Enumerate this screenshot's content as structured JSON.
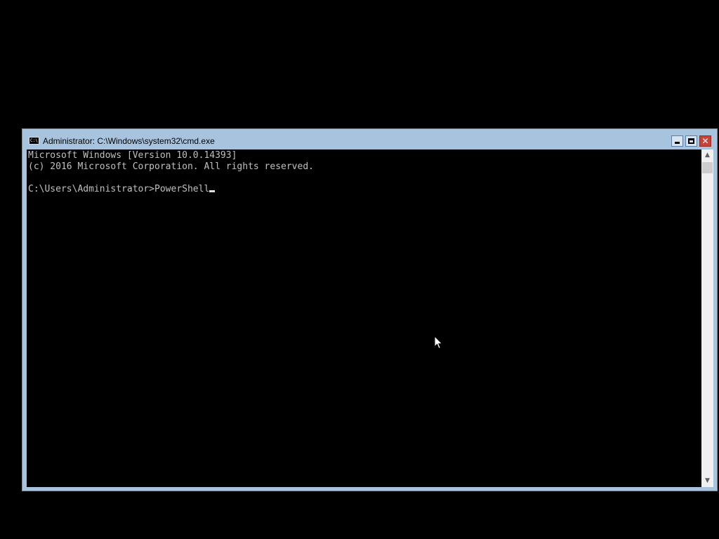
{
  "window": {
    "title": "Administrator: C:\\Windows\\system32\\cmd.exe",
    "app_icon_text": "C:\\",
    "controls": {
      "minimize_icon": "minimize-icon",
      "maximize_icon": "maximize-icon",
      "close_icon": "close-icon",
      "close_glyph": "✕"
    }
  },
  "console": {
    "line1": "Microsoft Windows [Version 10.0.14393]",
    "line2": "(c) 2016 Microsoft Corporation. All rights reserved.",
    "line3": "",
    "prompt": "C:\\Users\\Administrator>",
    "input": "PowerShell"
  },
  "scrollbar": {
    "up_glyph": "▲",
    "down_glyph": "▼"
  },
  "colors": {
    "desktop_background": "#000000",
    "window_frame": "#a8c3de",
    "console_background": "#000000",
    "console_text": "#c0c0c0",
    "close_button": "#c7433a"
  }
}
